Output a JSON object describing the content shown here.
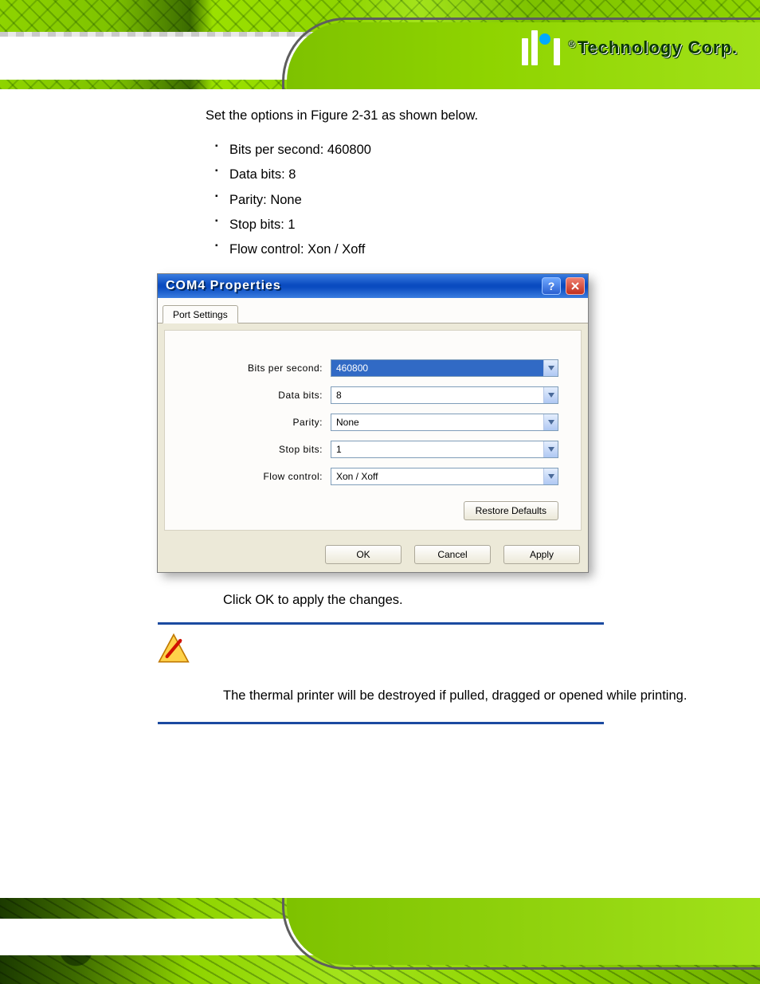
{
  "header": {
    "logo_text": "Technology Corp."
  },
  "body": {
    "intro": "Set the options in Figure 2-31 as shown below.",
    "options": [
      "Bits per second: 460800",
      "Data bits: 8",
      "Parity: None",
      "Stop bits: 1",
      "Flow control: Xon / Xoff"
    ],
    "step_after": "Click OK to apply the changes.",
    "warning": "The thermal printer will be destroyed if pulled, dragged or opened while printing."
  },
  "dialog": {
    "title": "COM4 Properties",
    "tab": "Port Settings",
    "fields": {
      "bps": {
        "label": "Bits per second:",
        "value": "460800"
      },
      "data": {
        "label": "Data bits:",
        "value": "8"
      },
      "parity": {
        "label": "Parity:",
        "value": "None"
      },
      "stop": {
        "label": "Stop bits:",
        "value": "1"
      },
      "flow": {
        "label": "Flow control:",
        "value": "Xon / Xoff"
      }
    },
    "buttons": {
      "restore": "Restore Defaults",
      "ok": "OK",
      "cancel": "Cancel",
      "apply": "Apply"
    }
  }
}
